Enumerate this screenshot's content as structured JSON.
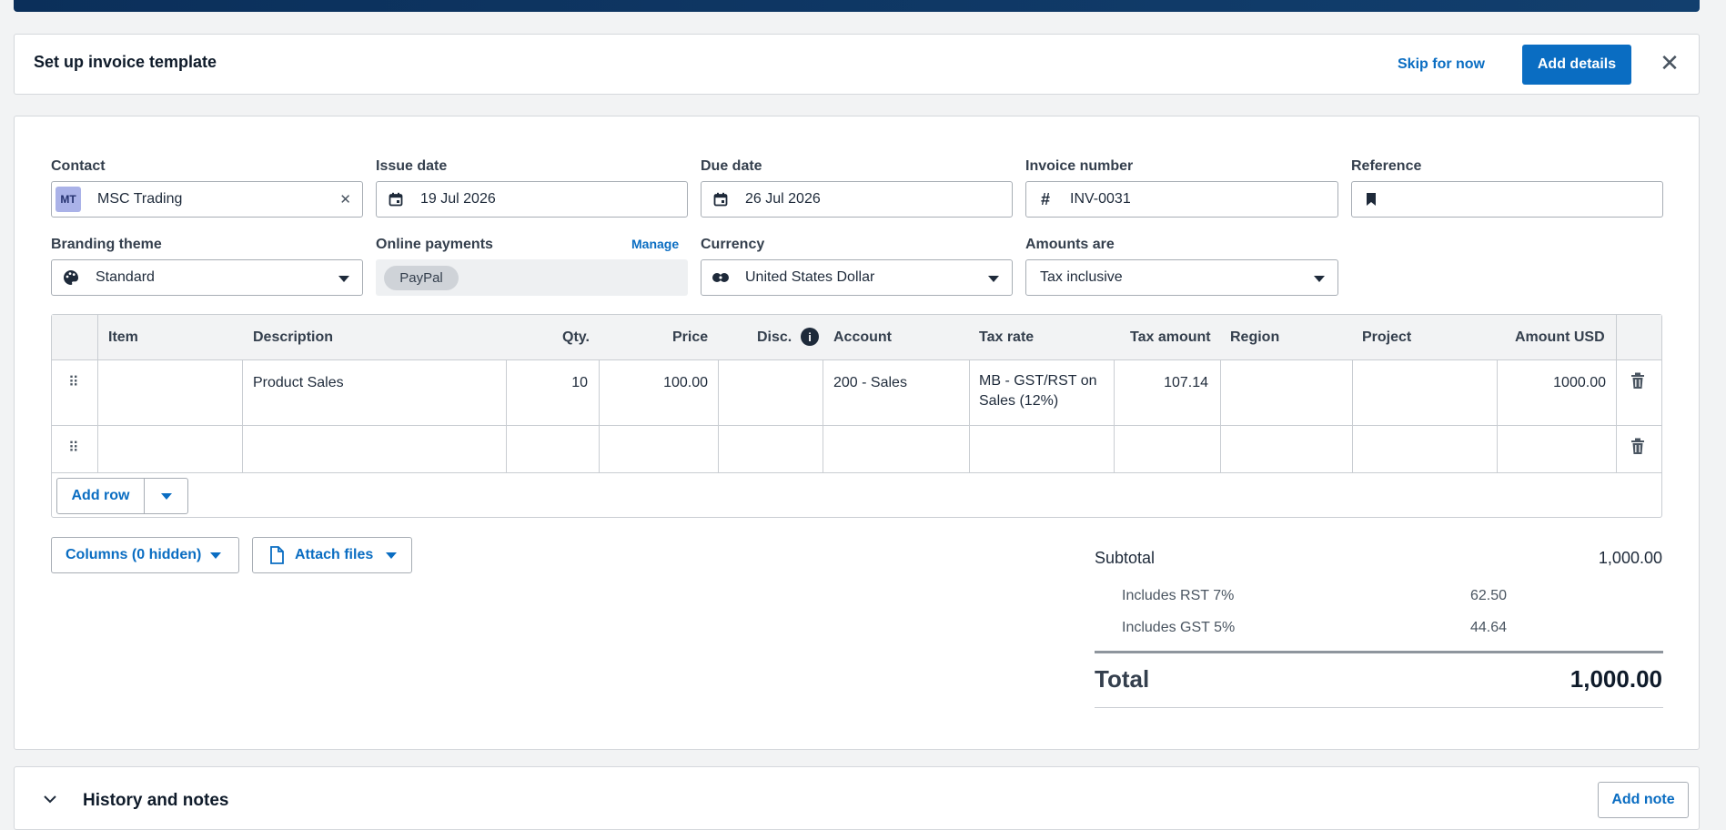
{
  "setup_banner": {
    "title": "Set up invoice template",
    "skip_label": "Skip for now",
    "add_details_label": "Add details"
  },
  "form": {
    "contact": {
      "label": "Contact",
      "initials": "MT",
      "value": "MSC Trading"
    },
    "issue_date": {
      "label": "Issue date",
      "value": "19 Jul 2026"
    },
    "due_date": {
      "label": "Due date",
      "value": "26 Jul 2026"
    },
    "invoice_number": {
      "label": "Invoice number",
      "value": "INV-0031"
    },
    "reference": {
      "label": "Reference",
      "value": ""
    },
    "branding_theme": {
      "label": "Branding theme",
      "value": "Standard"
    },
    "online_payments": {
      "label": "Online payments",
      "manage_label": "Manage",
      "provider": "PayPal"
    },
    "currency": {
      "label": "Currency",
      "value": "United States Dollar"
    },
    "amounts_are": {
      "label": "Amounts are",
      "value": "Tax inclusive"
    }
  },
  "table": {
    "columns": [
      "Item",
      "Description",
      "Qty.",
      "Price",
      "Disc.",
      "Account",
      "Tax rate",
      "Tax amount",
      "Region",
      "Project",
      "Amount USD"
    ],
    "rows": [
      {
        "item": "",
        "description": "Product Sales",
        "qty": "10",
        "price": "100.00",
        "disc": "",
        "account": "200 - Sales",
        "tax_rate_line1": "MB - GST/RST on",
        "tax_rate_line2": "Sales (12%)",
        "tax_amount": "107.14",
        "region": "",
        "project": "",
        "amount": "1000.00"
      },
      {
        "item": "",
        "description": "",
        "qty": "",
        "price": "",
        "disc": "",
        "account": "",
        "tax_rate_line1": "",
        "tax_rate_line2": "",
        "tax_amount": "",
        "region": "",
        "project": "",
        "amount": ""
      }
    ],
    "add_row_label": "Add row"
  },
  "actions": {
    "columns_label": "Columns (0 hidden)",
    "attach_label": "Attach files"
  },
  "summary": {
    "subtotal_label": "Subtotal",
    "subtotal_value": "1,000.00",
    "taxes": [
      {
        "label": "Includes RST 7%",
        "value": "62.50"
      },
      {
        "label": "Includes GST 5%",
        "value": "44.64"
      }
    ],
    "total_label": "Total",
    "total_value": "1,000.00"
  },
  "history": {
    "title": "History and notes",
    "add_note_label": "Add note"
  },
  "colors": {
    "accent": "#0a6dc2",
    "header_bar": "#0b2f5a",
    "badge": "#aab2e8"
  }
}
